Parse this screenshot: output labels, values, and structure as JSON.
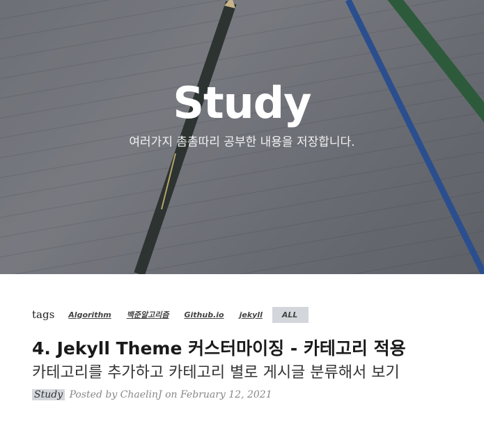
{
  "header": {
    "title": "Study",
    "subtitle": "여러가지 촘촘따리 공부한 내용을 저장합니다."
  },
  "tags": {
    "label": "tags",
    "items": [
      "Algorithm",
      "백준알고리즘",
      "Github.io",
      "jekyll"
    ],
    "all_label": "ALL"
  },
  "post": {
    "title": "4. Jekyll Theme 커스터마이징 - 카테고리 적용",
    "subtitle": "카테고리를 추가하고 카테고리 별로 게시글 분류해서 보기",
    "category": "Study",
    "meta": "Posted by ChaelinJ on February 12, 2021"
  }
}
